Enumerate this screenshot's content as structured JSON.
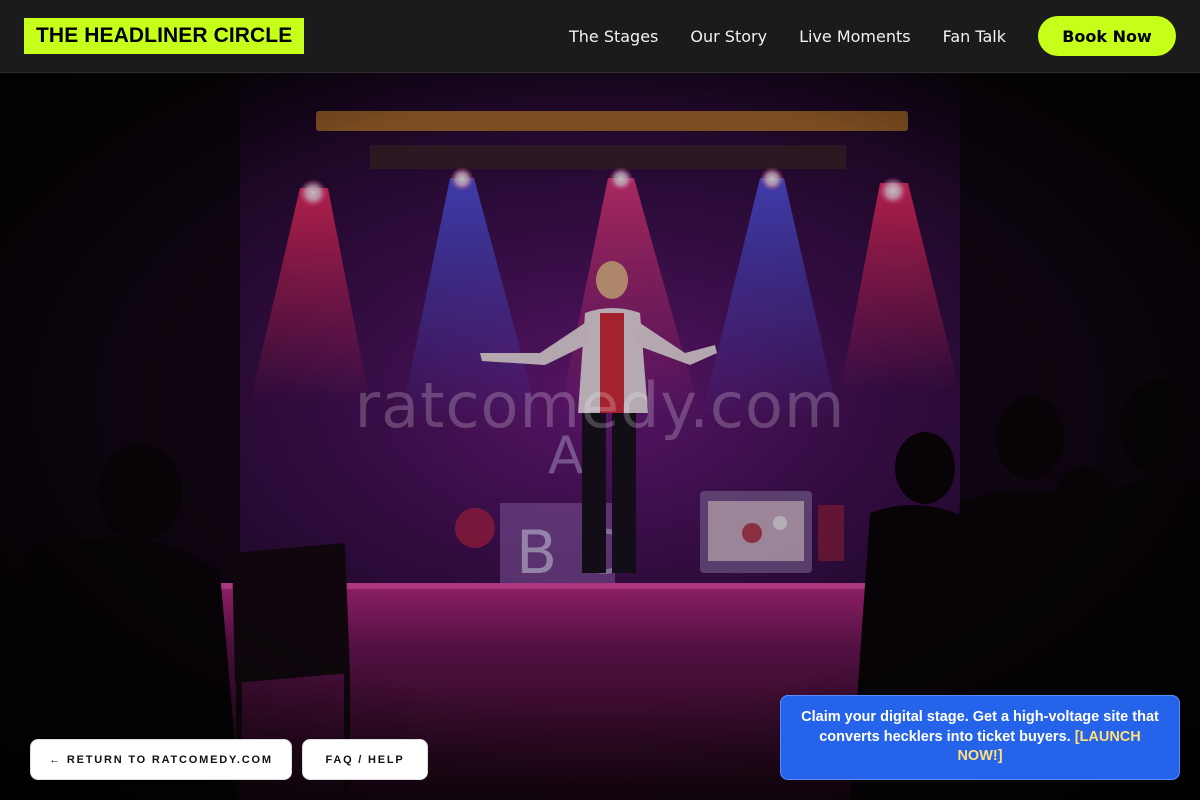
{
  "header": {
    "logo": "THE HEADLINER CIRCLE",
    "nav": [
      "The Stages",
      "Our Story",
      "Live Moments",
      "Fan Talk"
    ],
    "cta": "Book Now"
  },
  "hero": {
    "watermark": "ratcomedy.com",
    "props_text": "A BC"
  },
  "footer": {
    "return_label": "← RETURN TO RATCOMEDY.COM",
    "faq_label": "FAQ / HELP"
  },
  "promo": {
    "text": "Claim your digital stage. Get a high-voltage site that converts hecklers into ticket buyers.",
    "link": "[LAUNCH NOW!]"
  },
  "colors": {
    "accent": "#c6ff1a",
    "header_bg": "#1b1b1b",
    "promo_bg": "#2563eb",
    "promo_link": "#ffe07a"
  }
}
